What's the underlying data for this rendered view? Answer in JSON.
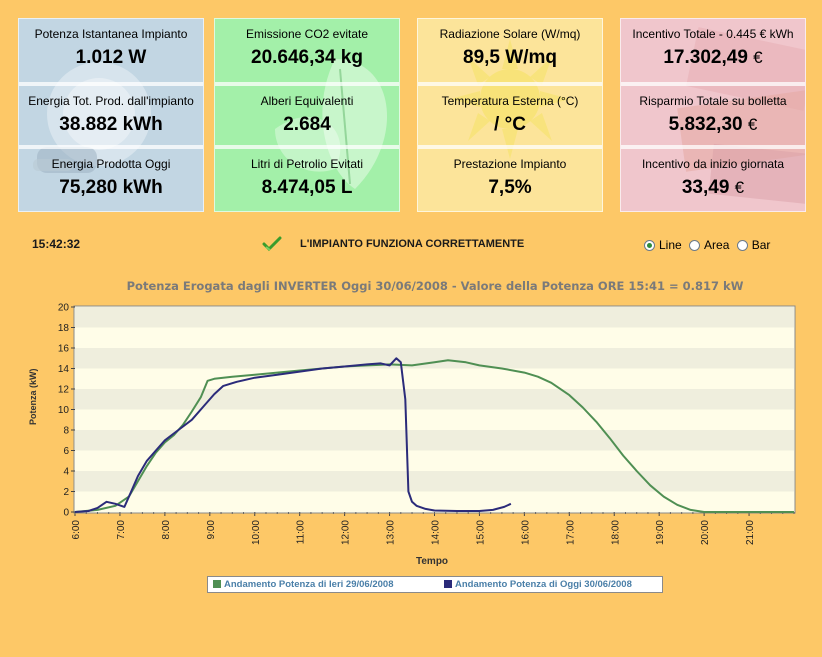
{
  "colors": {
    "page_bg": "#fdc867",
    "panel_blue": "#c2d6e3",
    "panel_green": "#a3f0a9",
    "panel_yellow": "#fce49a",
    "panel_pink": "#f0c6cc",
    "series_yesterday": "#4f8f53",
    "series_today": "#2b2b7a"
  },
  "panels": [
    {
      "decor_icon": "light-bulb-icon",
      "cells": [
        {
          "label": "Potenza Istantanea Impianto",
          "value": "1.012 W",
          "unit": ""
        },
        {
          "label": "Energia Tot. Prod. dall'impianto",
          "value": "38.882 kWh",
          "unit": ""
        },
        {
          "label": "Energia Prodotta Oggi",
          "value": "75,280 kWh",
          "unit": ""
        }
      ]
    },
    {
      "decor_icon": "leaf-icon",
      "cells": [
        {
          "label": "Emissione CO2 evitate",
          "value": "20.646,34 kg",
          "unit": ""
        },
        {
          "label": "Alberi Equivalenti",
          "value": "2.684",
          "unit": ""
        },
        {
          "label": "Litri di Petrolio Evitati",
          "value": "8.474,05 L",
          "unit": ""
        }
      ]
    },
    {
      "decor_icon": "sun-icon",
      "cells": [
        {
          "label": "Radiazione Solare (W/mq)",
          "value": "89,5 W/mq",
          "unit": ""
        },
        {
          "label": "Temperatura Esterna (°C)",
          "value": "/ °C",
          "unit": ""
        },
        {
          "label": "Prestazione Impianto",
          "value": "7,5%",
          "unit": ""
        }
      ]
    },
    {
      "decor_icon": "euro-banknotes-icon",
      "cells": [
        {
          "label": "Incentivo Totale - 0.445 € kWh",
          "value": "17.302,49",
          "unit": "€"
        },
        {
          "label": "Risparmio Totale su bolletta",
          "value": "5.832,30",
          "unit": "€"
        },
        {
          "label": "Incentivo da inizio giornata",
          "value": "33,49",
          "unit": "€"
        }
      ]
    }
  ],
  "status": {
    "time": "15:42:32",
    "icon": "checkmark-icon",
    "message": "L'IMPIANTO FUNZIONA CORRETTAMENTE"
  },
  "chart_type_options": [
    {
      "label": "Line",
      "selected": true
    },
    {
      "label": "Area",
      "selected": false
    },
    {
      "label": "Bar",
      "selected": false
    }
  ],
  "chart_data": {
    "type": "line",
    "title": "Potenza Erogata dagli INVERTER Oggi 30/06/2008 - Valore della Potenza ORE 15:41 = 0.817 kW",
    "xlabel": "Tempo",
    "ylabel": "Potenza (kW)",
    "xlim": [
      6.0,
      22.0
    ],
    "ylim": [
      0,
      20
    ],
    "x_ticks": [
      "6:00",
      "7:00",
      "8:00",
      "9:00",
      "10:00",
      "11:00",
      "12:00",
      "13:00",
      "14:00",
      "15:00",
      "16:00",
      "17:00",
      "18:00",
      "19:00",
      "20:00",
      "21:00"
    ],
    "y_ticks": [
      0,
      2,
      4,
      6,
      8,
      10,
      12,
      14,
      16,
      18,
      20
    ],
    "grid": true,
    "legend_position": "bottom",
    "series": [
      {
        "name": "Andamento Potenza di Ieri 29/06/2008",
        "color": "#4f8f53",
        "x": [
          6.0,
          6.5,
          6.9,
          7.2,
          7.4,
          7.6,
          7.8,
          8.0,
          8.2,
          8.4,
          8.6,
          8.8,
          8.95,
          9.1,
          9.5,
          10.0,
          10.5,
          11.0,
          11.5,
          12.0,
          12.5,
          13.0,
          13.5,
          14.0,
          14.3,
          14.7,
          15.0,
          15.5,
          16.0,
          16.3,
          16.6,
          17.0,
          17.3,
          17.6,
          17.9,
          18.2,
          18.5,
          18.8,
          19.1,
          19.4,
          19.7,
          20.0,
          20.5,
          21.0,
          21.5,
          22.0
        ],
        "y": [
          0.0,
          0.2,
          0.6,
          1.5,
          3.0,
          4.5,
          5.8,
          6.8,
          7.5,
          8.5,
          9.8,
          11.2,
          12.8,
          13.0,
          13.2,
          13.4,
          13.6,
          13.8,
          14.0,
          14.2,
          14.3,
          14.4,
          14.3,
          14.6,
          14.8,
          14.6,
          14.3,
          14.0,
          13.6,
          13.2,
          12.6,
          11.4,
          10.2,
          8.8,
          7.2,
          5.5,
          4.0,
          2.6,
          1.5,
          0.7,
          0.2,
          0.0,
          0.0,
          0.0,
          0.0,
          0.0
        ]
      },
      {
        "name": "Andamento Potenza di Oggi 30/06/2008",
        "color": "#2b2b7a",
        "x": [
          6.0,
          6.3,
          6.5,
          6.7,
          6.9,
          7.1,
          7.25,
          7.4,
          7.6,
          7.8,
          8.0,
          8.3,
          8.6,
          8.9,
          9.1,
          9.3,
          9.6,
          10.0,
          10.5,
          11.0,
          11.5,
          12.0,
          12.5,
          12.8,
          13.0,
          13.15,
          13.25,
          13.35,
          13.42,
          13.5,
          13.6,
          13.8,
          14.0,
          14.5,
          15.0,
          15.3,
          15.55,
          15.7
        ],
        "y": [
          0.0,
          0.1,
          0.4,
          1.0,
          0.8,
          0.5,
          2.0,
          3.5,
          5.0,
          6.0,
          7.0,
          8.0,
          9.0,
          10.5,
          11.5,
          12.3,
          12.7,
          13.1,
          13.4,
          13.7,
          14.0,
          14.2,
          14.4,
          14.5,
          14.3,
          15.0,
          14.6,
          11.0,
          2.0,
          1.0,
          0.6,
          0.3,
          0.15,
          0.1,
          0.1,
          0.2,
          0.5,
          0.8
        ]
      }
    ]
  }
}
